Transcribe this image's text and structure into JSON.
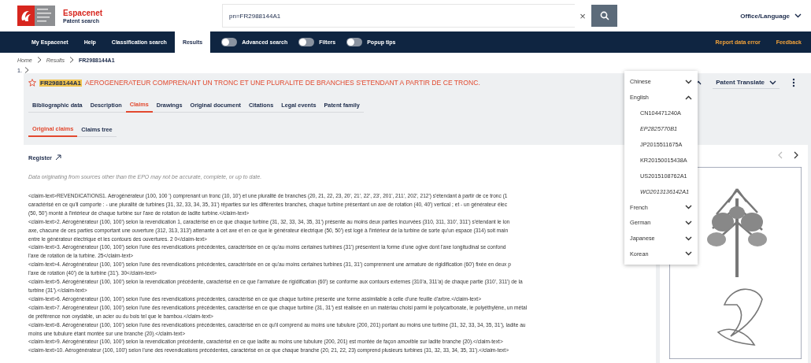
{
  "header": {
    "brand_name": "Espacenet",
    "brand_subtitle": "Patent search",
    "search": {
      "value": "pn=FR2988144A1"
    },
    "clear": "×",
    "office_language": "Office/Language"
  },
  "nav": {
    "items": [
      {
        "label": "My Espacenet",
        "selected": false
      },
      {
        "label": "Help",
        "selected": false
      },
      {
        "label": "Classification search",
        "selected": false
      },
      {
        "label": "Results",
        "selected": true
      }
    ],
    "toggles": [
      {
        "label": "Advanced search",
        "on": false
      },
      {
        "label": "Filters",
        "on": false
      },
      {
        "label": "Popup tips",
        "on": false
      }
    ],
    "links": [
      "Report data error",
      "Feedback"
    ]
  },
  "breadcrumb": [
    "Home",
    "Results",
    "FR2988144A1"
  ],
  "result_index": "1.",
  "document": {
    "number": "FR2988144A1",
    "title": "AEROGENERATEUR COMPRENANT UN TRONC ET UNE PLURALITE DE BRANCHES S'ETENDANT A PARTIR DE CE TRONC.",
    "starred": false,
    "translate": "Patent Translate"
  },
  "tabs": [
    {
      "label": "Bibliographic data",
      "selected": false
    },
    {
      "label": "Description",
      "selected": false
    },
    {
      "label": "Claims",
      "selected": true
    },
    {
      "label": "Drawings",
      "selected": false
    },
    {
      "label": "Original document",
      "selected": false
    },
    {
      "label": "Citations",
      "selected": false
    },
    {
      "label": "Legal events",
      "selected": false
    },
    {
      "label": "Patent family",
      "selected": false
    }
  ],
  "subtabs": [
    {
      "label": "Original claims",
      "selected": true
    },
    {
      "label": "Claims tree",
      "selected": false
    }
  ],
  "register": "Register",
  "disclaimer": "Data originating from sources other than the EPO may not be accurate, complete, or up to date.",
  "claim_lines": [
    "<claim-text>REVENDICATIONS1. Aérogénérateur (100, 100 ') comprenant un tronc (10, 10') et une pluralité de branches (20, 21, 22, 23, 20', 21', 22', 23', 201', 211', 202', 212') s'étendant à partir de ce tronc (1",
    "caractérisé en ce qu'il comporte : - une pluralité de turbines (31, 32, 33, 34, 35, 31') réparties sur les différentes branches, chaque turbine présentant un axe de rotation (40, 40') vertical ; et - un générateur élec",
    "(50, 50') monté à l'intérieur de chaque turbine sur l'axe de rotation de ladite turbine.</claim-text>",
    "<claim-text>2. Aérogénérateur (100, 100') selon la revendication 1, caractérisé en ce que chaque turbine (31, 32, 33, 34, 35, 31') présente au moins deux parties incurvées (310, 311, 310', 311') s'étendant le lon",
    "axe, chacune de ces parties comportant une ouverture (312, 313, 313') attenante à cet axe et en ce que le générateur électrique (50, 50') est logé à l'intérieur de la turbine de sorte qu'un espace (314) soit main",
    "entre le générateur électrique et les contours des ouvertures. 2 0</claim-text>",
    "<claim-text>3. Aérogénérateur (100, 100') selon l'une des revendications précédentes, caractérisée en ce qu'au moins certaines turbines (31') présentent la forme d'une ogive dont l'axe longitudinal se confond",
    "l'axe de rotation de la turbine. 25</claim-text>",
    "<claim-text>4. Aérogénérateur (100, 100') selon l'une des revendications précédentes, caractérisée en ce qu'au moins certaines turbines (31, 31') comprennent une armature de rigidification (60') fixée en deux p",
    "l'axe de rotation (40') de la turbine (31'). 30</claim-text>",
    "<claim-text>5. Aérogénérateur (100, 100') selon la revendication précédente, caractérisé en ce que l'armature de rigidification (60') se conforme aux contours externes (310'a, 311'a) de chaque partie (310', 311') de la",
    "turbine (31').</claim-text>",
    "<claim-text>6. Aérogénérateur (100, 100') selon l'une des revendications précédentes, caractérisé en ce que chaque turbine présente une forme assimilable à celle d'une feuille d'arbre.</claim-text>",
    "<claim-text>7. Aérogénérateur (100, 100') selon l'une des revendications précédentes, caractérisé en ce que chaque turbine (31, 31') est réalisée en un matériau choisi parmi le polycarbonate, le polyéthylène, un métal",
    "de préférence non oxydable, un acier ou du bois tel que le bambou.</claim-text>",
    "<claim-text>8. Aérogénérateur (100, 100') selon l'une des revendications précédentes, caractérisé en ce qu'il comprend au moins une tubulure (200, 201) portant au moins une turbine (31, 32, 33, 34, 35, 31'), ladite au",
    "moins une tubulure étant montée sur une branche (20).</claim-text>",
    "<claim-text>9. Aérogénérateur (100, 100') selon la revendication précédente, caractérisé en ce que ladite au moins une tubulure (200, 201) est montée de façon amovible sur ladite branche (20).</claim-text>",
    "<claim-text>10. Aérogénérateur (100, 100') selon l'une des revendications précédentes, caractérisé en ce que chaque branche (20, 21, 22, 23) comprend plusieurs turbines (31, 32, 33, 34, 35, 31').</claim-text>"
  ],
  "language_menu": [
    {
      "label": "Chinese",
      "expanded": false
    },
    {
      "label": "English",
      "expanded": true,
      "children": [
        {
          "label": "CN104471240A",
          "italic": false
        },
        {
          "label": "EP2825770B1",
          "italic": true
        },
        {
          "label": "JP2015511675A",
          "italic": false
        },
        {
          "label": "KR20150015438A",
          "italic": false
        },
        {
          "label": "US2015108762A1",
          "italic": false
        },
        {
          "label": "WO2013136142A1",
          "italic": true
        }
      ]
    },
    {
      "label": "French",
      "expanded": false
    },
    {
      "label": "German",
      "expanded": false
    },
    {
      "label": "Japanese",
      "expanded": false
    },
    {
      "label": "Korean",
      "expanded": false
    }
  ]
}
